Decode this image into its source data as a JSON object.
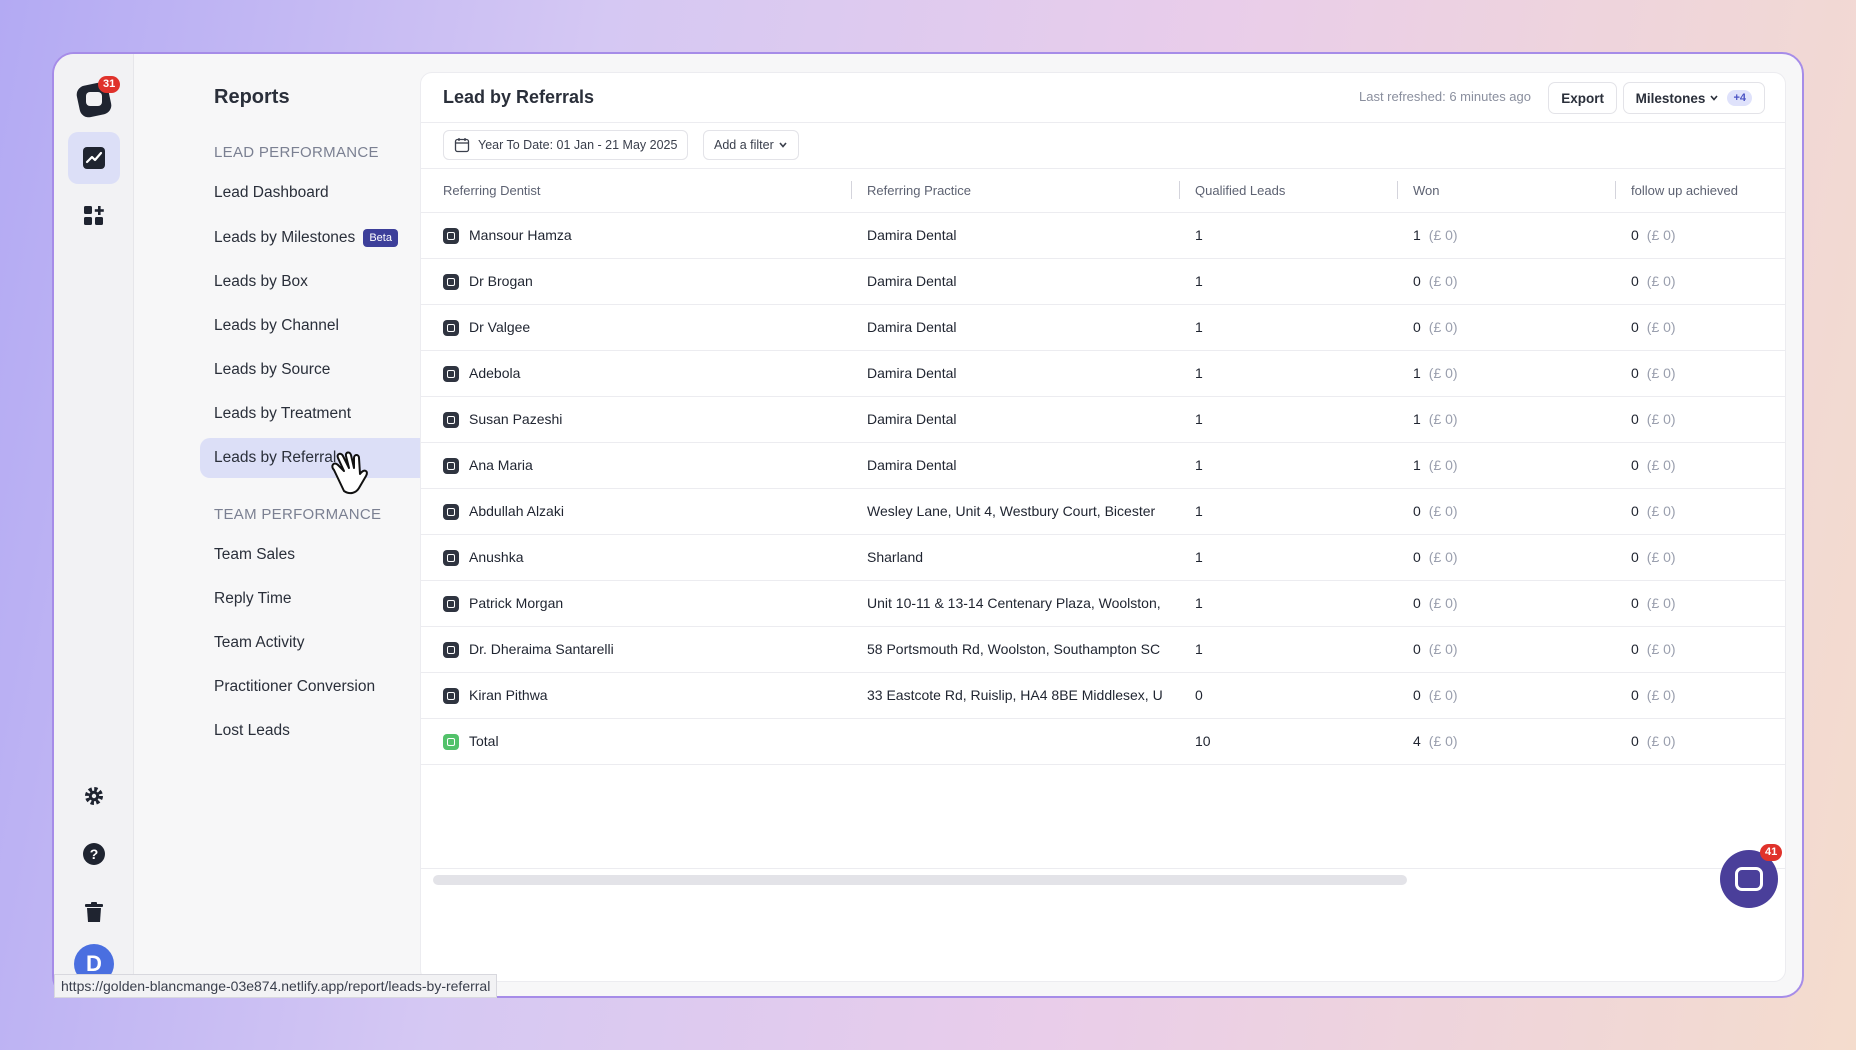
{
  "rail": {
    "notification_count": "31",
    "items": [
      {
        "name": "reports",
        "icon": "trend-chart-icon",
        "active": true
      },
      {
        "name": "apps",
        "icon": "grid-plus-icon",
        "active": false
      }
    ],
    "bottom": [
      "gear-icon",
      "help-icon",
      "trash-icon"
    ],
    "avatar_initial": "D"
  },
  "sidebar": {
    "title": "Reports",
    "sections": [
      {
        "label": "LEAD PERFORMANCE",
        "items": [
          {
            "label": "Lead Dashboard"
          },
          {
            "label": "Leads by Milestones",
            "badge": "Beta"
          },
          {
            "label": "Leads by Box"
          },
          {
            "label": "Leads by Channel"
          },
          {
            "label": "Leads by Source"
          },
          {
            "label": "Leads by Treatment"
          },
          {
            "label": "Leads by Referral",
            "active": true
          }
        ]
      },
      {
        "label": "TEAM PERFORMANCE",
        "items": [
          {
            "label": "Team Sales"
          },
          {
            "label": "Reply Time"
          },
          {
            "label": "Team Activity"
          },
          {
            "label": "Practitioner Conversion"
          },
          {
            "label": "Lost Leads"
          }
        ]
      }
    ]
  },
  "main": {
    "title": "Lead by Referrals",
    "last_refreshed": "Last refreshed: 6 minutes ago",
    "export_label": "Export",
    "milestones_label": "Milestones",
    "milestones_extra": "+4",
    "date_filter": "Year To Date: 01 Jan - 21 May 2025",
    "add_filter": "Add a filter"
  },
  "table": {
    "columns": [
      "Referring Dentist",
      "Referring Practice",
      "Qualified Leads",
      "Won",
      "follow up achieved"
    ],
    "rows": [
      {
        "dentist": "Mansour Hamza",
        "practice": "Damira Dental",
        "qualified": "1",
        "won": "1",
        "won_value": "(£ 0)",
        "follow": "0",
        "follow_value": "(£ 0)"
      },
      {
        "dentist": "Dr Brogan",
        "practice": "Damira Dental",
        "qualified": "1",
        "won": "0",
        "won_value": "(£ 0)",
        "follow": "0",
        "follow_value": "(£ 0)"
      },
      {
        "dentist": "Dr Valgee",
        "practice": "Damira Dental",
        "qualified": "1",
        "won": "0",
        "won_value": "(£ 0)",
        "follow": "0",
        "follow_value": "(£ 0)"
      },
      {
        "dentist": "Adebola",
        "practice": "Damira Dental",
        "qualified": "1",
        "won": "1",
        "won_value": "(£ 0)",
        "follow": "0",
        "follow_value": "(£ 0)"
      },
      {
        "dentist": "Susan Pazeshi",
        "practice": "Damira Dental",
        "qualified": "1",
        "won": "1",
        "won_value": "(£ 0)",
        "follow": "0",
        "follow_value": "(£ 0)"
      },
      {
        "dentist": "Ana Maria",
        "practice": "Damira Dental",
        "qualified": "1",
        "won": "1",
        "won_value": "(£ 0)",
        "follow": "0",
        "follow_value": "(£ 0)"
      },
      {
        "dentist": "Abdullah Alzaki",
        "practice": "Wesley Lane, Unit 4, Westbury Court, Bicester",
        "qualified": "1",
        "won": "0",
        "won_value": "(£ 0)",
        "follow": "0",
        "follow_value": "(£ 0)"
      },
      {
        "dentist": "Anushka",
        "practice": "Sharland",
        "qualified": "1",
        "won": "0",
        "won_value": "(£ 0)",
        "follow": "0",
        "follow_value": "(£ 0)"
      },
      {
        "dentist": "Patrick Morgan",
        "practice": "Unit 10-11 & 13-14 Centenary Plaza, Woolston,",
        "qualified": "1",
        "won": "0",
        "won_value": "(£ 0)",
        "follow": "0",
        "follow_value": "(£ 0)"
      },
      {
        "dentist": "Dr. Dheraima Santarelli",
        "practice": "58 Portsmouth Rd, Woolston, Southampton SC",
        "qualified": "1",
        "won": "0",
        "won_value": "(£ 0)",
        "follow": "0",
        "follow_value": "(£ 0)"
      },
      {
        "dentist": "Kiran Pithwa",
        "practice": "33 Eastcote Rd, Ruislip, HA4 8BE Middlesex, U",
        "qualified": "0",
        "won": "0",
        "won_value": "(£ 0)",
        "follow": "0",
        "follow_value": "(£ 0)"
      }
    ],
    "total": {
      "label": "Total",
      "qualified": "10",
      "won": "4",
      "won_value": "(£ 0)",
      "follow": "0",
      "follow_value": "(£ 0)"
    }
  },
  "chat": {
    "unread": "41"
  },
  "status_url": "https://golden-blancmange-03e874.netlify.app/report/leads-by-referral",
  "colors": {
    "accent": "#4a3f9a",
    "active_bg": "#dcdff7",
    "badge_red": "#e0322b",
    "total_icon": "#52c26a"
  }
}
